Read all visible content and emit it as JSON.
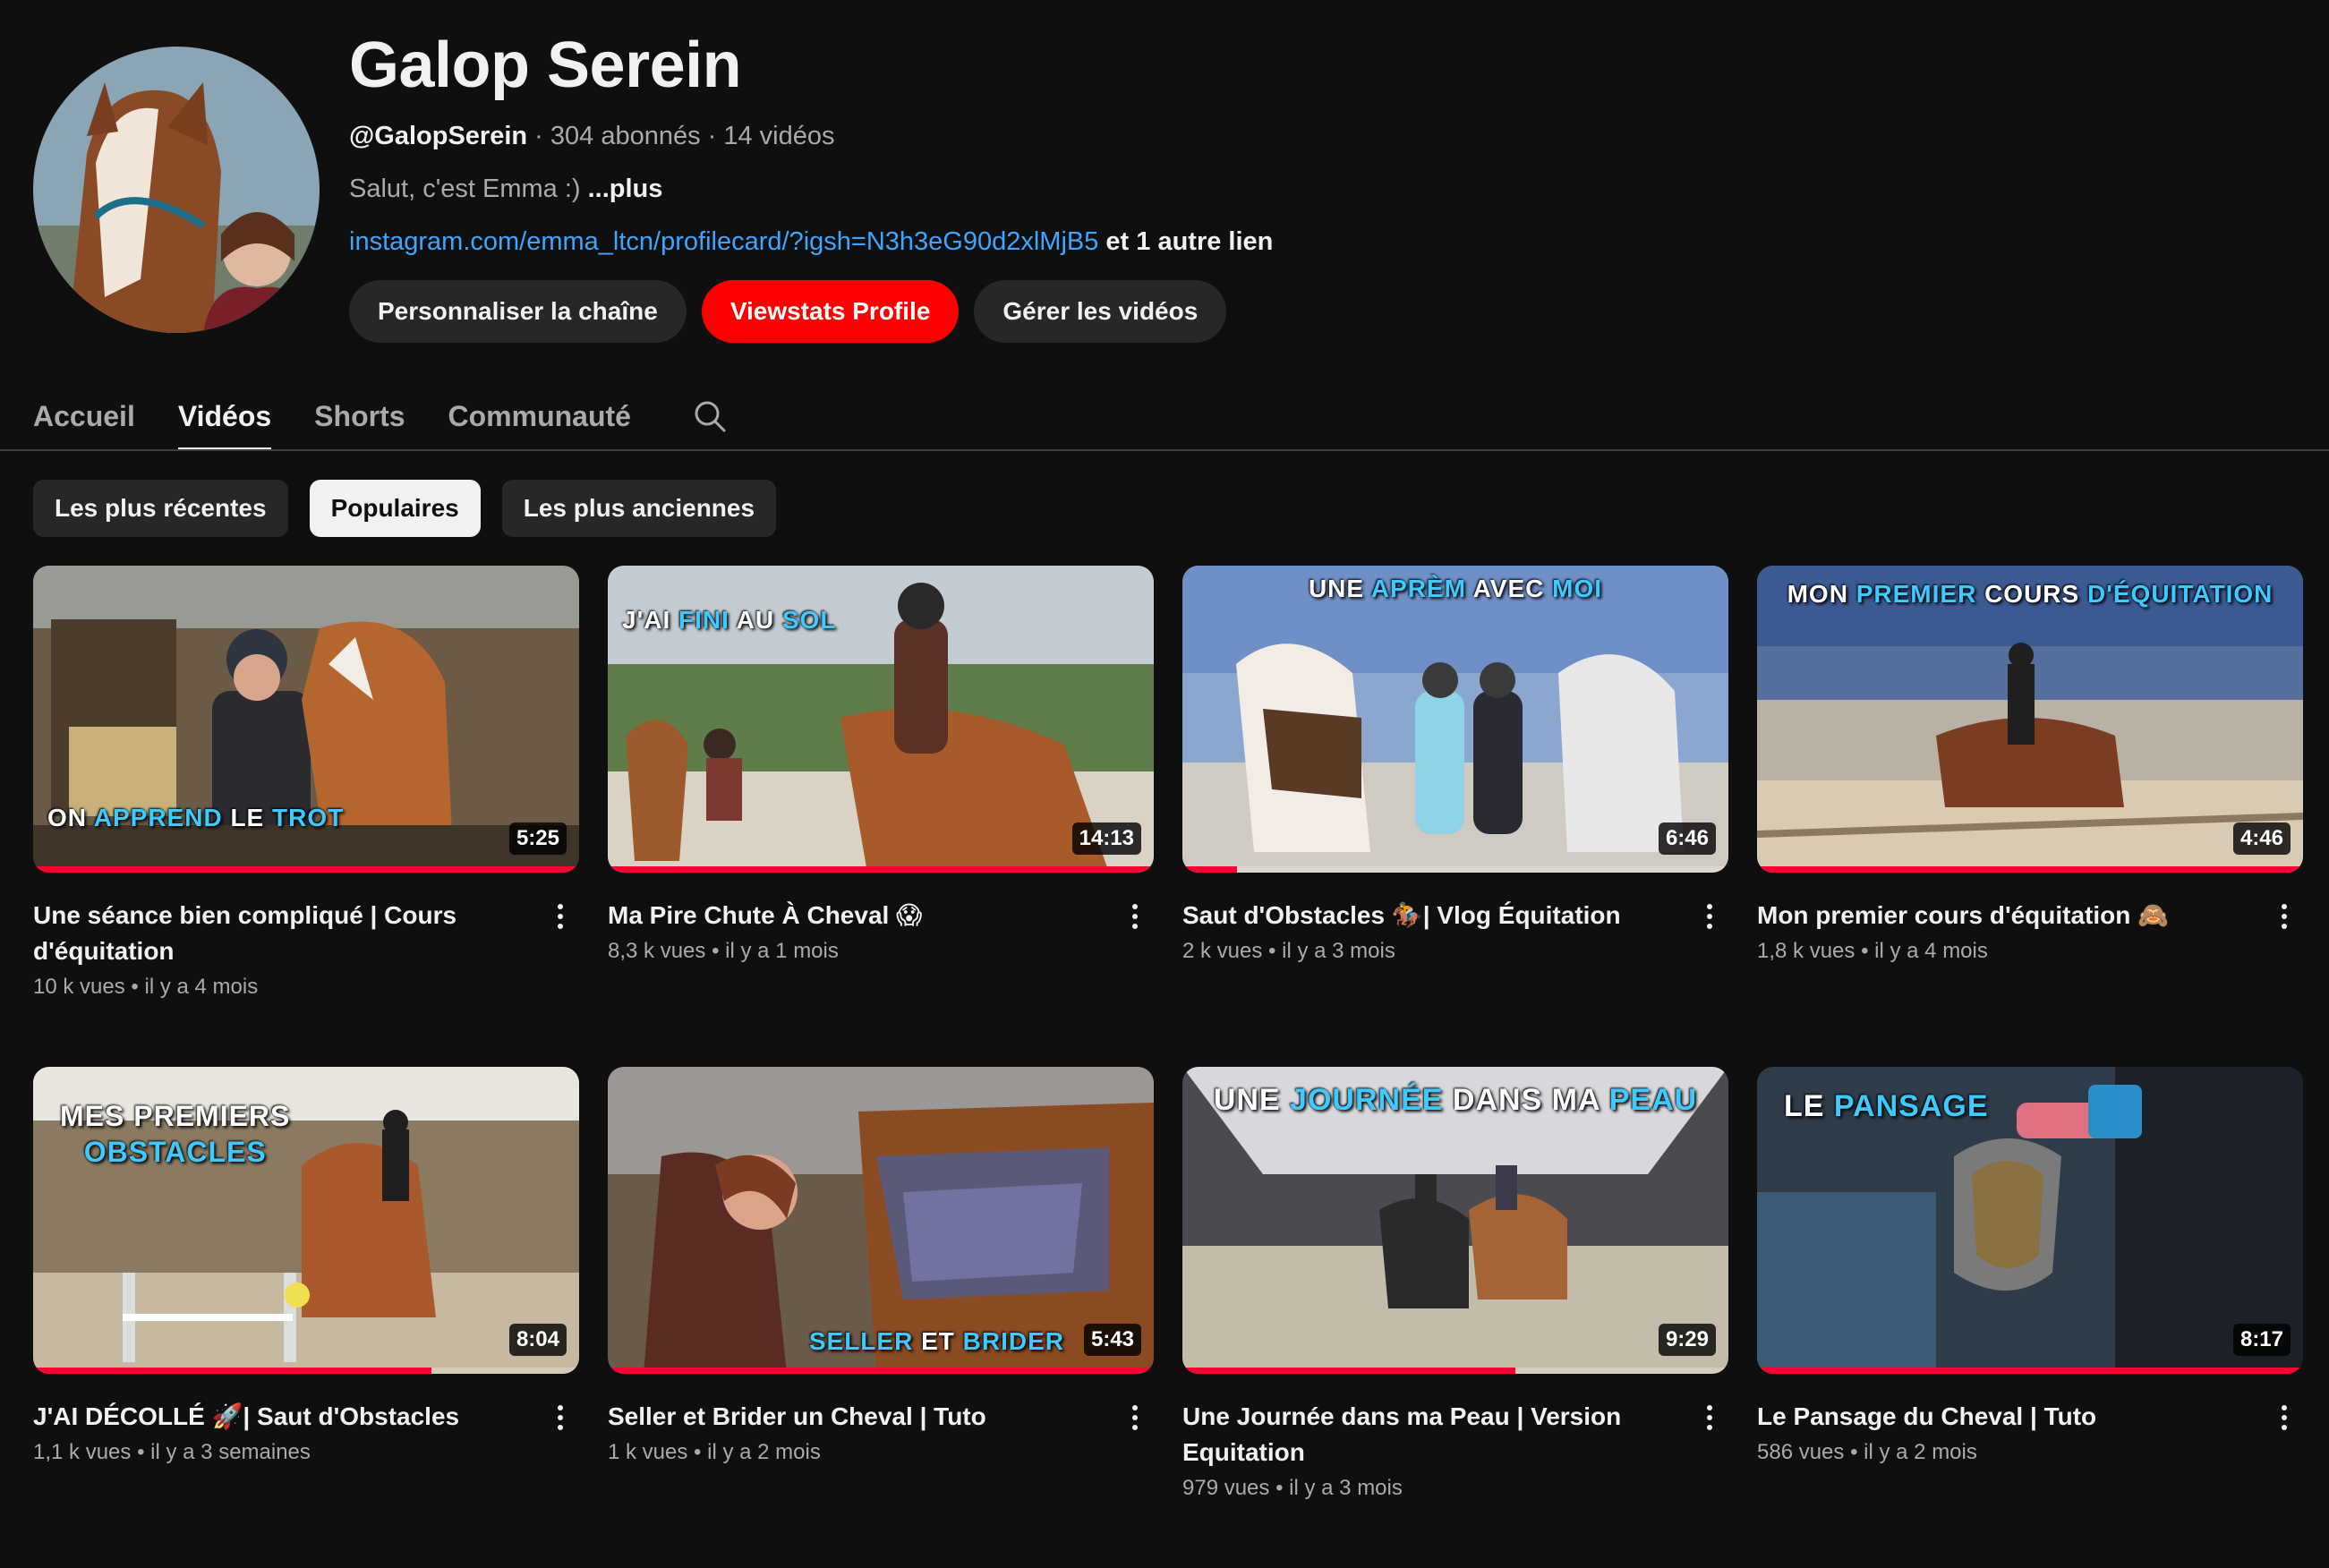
{
  "channel": {
    "name": "Galop Serein",
    "handle": "@GalopSerein",
    "stats": " · 304 abonnés · 14 vidéos",
    "description": "Salut, c'est Emma :) ",
    "description_more": "...plus",
    "link": "instagram.com/emma_ltcn/profilecard/?igsh=N3h3eG90d2xlMjB5",
    "link_extra": " et 1 autre lien"
  },
  "actions": {
    "customize": "Personnaliser la chaîne",
    "viewstats": "Viewstats Profile",
    "manage": "Gérer les vidéos"
  },
  "tabs": [
    "Accueil",
    "Vidéos",
    "Shorts",
    "Communauté"
  ],
  "active_tab": "Vidéos",
  "filters": [
    "Les plus récentes",
    "Populaires",
    "Les plus anciennes"
  ],
  "active_filter": "Populaires",
  "colors": {
    "accent": "#ff0000",
    "link": "#3ea6ff",
    "progress": "#ff0033",
    "overlay_highlight": "#3ec9ff"
  },
  "videos": [
    {
      "title": "Une séance bien compliqué | Cours d'équitation",
      "views": "10 k vues",
      "age": "il y a 4 mois",
      "duration": "5:25",
      "progress": 1.0,
      "overlay": {
        "a": "ON ",
        "b": "APPREND",
        "c": " LE ",
        "d": "TROT"
      }
    },
    {
      "title": "Ma Pire Chute À Cheval 😱",
      "views": "8,3 k vues",
      "age": "il y a 1 mois",
      "duration": "14:13",
      "progress": 1.0,
      "overlay": {
        "a": "J'AI ",
        "b": "FINI",
        "c": " AU ",
        "d": "SOL"
      }
    },
    {
      "title": "Saut d'Obstacles 🏇| Vlog Équitation",
      "views": "2 k vues",
      "age": "il y a 3 mois",
      "duration": "6:46",
      "progress": 0.1,
      "overlay": {
        "a": "UNE ",
        "b": "APRÈM",
        "c": " AVEC ",
        "d": "MOI"
      }
    },
    {
      "title": "Mon premier cours d'équitation 🙈",
      "views": "1,8 k vues",
      "age": "il y a 4 mois",
      "duration": "4:46",
      "progress": 1.0,
      "overlay": {
        "a": "MON ",
        "b": "PREMIER",
        "c": " COURS ",
        "d": "D'ÉQUITATION"
      }
    },
    {
      "title": "J'AI DÉCOLLÉ 🚀| Saut d'Obstacles",
      "views": "1,1 k vues",
      "age": "il y a 3 semaines",
      "duration": "8:04",
      "progress": 0.73,
      "overlay": {
        "a": "MES PREMIERS",
        "b": "OBSTACLES",
        "c": "",
        "d": ""
      }
    },
    {
      "title": "Seller et Brider un Cheval | Tuto",
      "views": "1 k vues",
      "age": "il y a 2 mois",
      "duration": "5:43",
      "progress": 1.0,
      "overlay": {
        "a": "",
        "b": "SELLER",
        "c": " ET ",
        "d": "BRIDER"
      }
    },
    {
      "title": "Une Journée dans ma Peau | Version Equitation",
      "views": "979 vues",
      "age": "il y a 3 mois",
      "duration": "9:29",
      "progress": 0.61,
      "overlay": {
        "a": "UNE ",
        "b": "JOURNÉE",
        "c": " DANS MA ",
        "d": "PEAU"
      }
    },
    {
      "title": "Le Pansage du Cheval | Tuto",
      "views": "586 vues",
      "age": "il y a 2 mois",
      "duration": "8:17",
      "progress": 1.0,
      "overlay": {
        "a": "LE ",
        "b": "PANSAGE",
        "c": "",
        "d": ""
      }
    }
  ]
}
